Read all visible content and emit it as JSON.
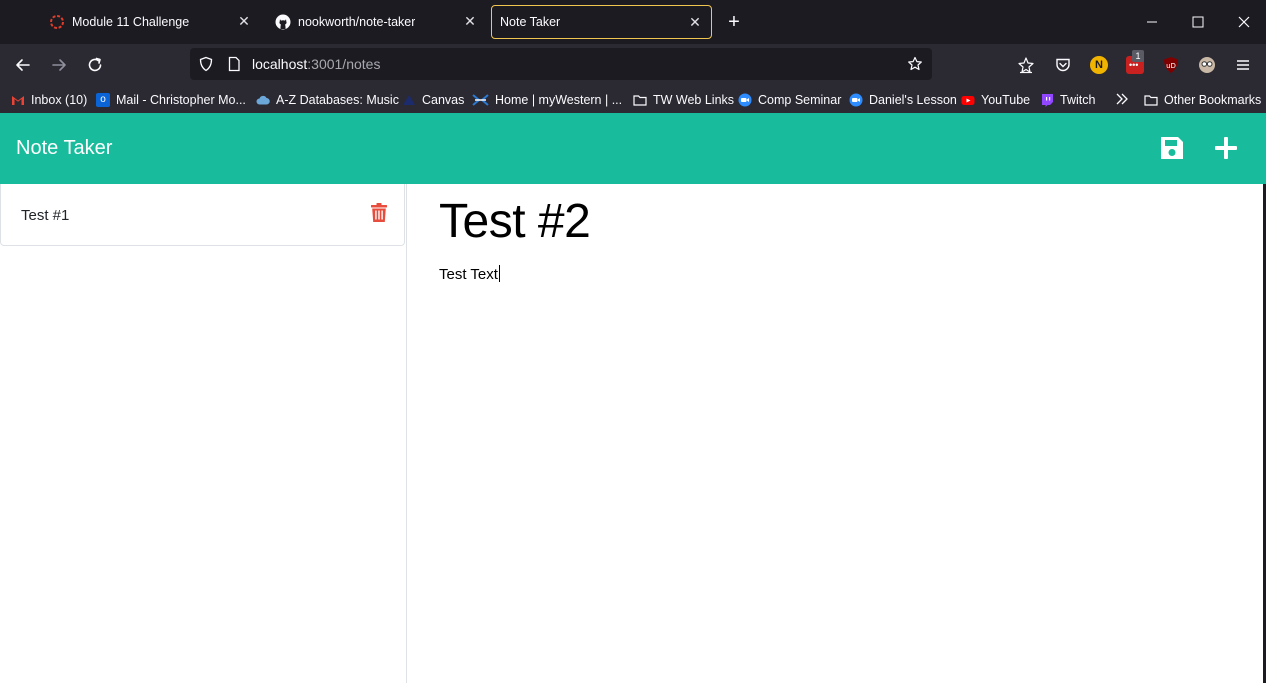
{
  "browser": {
    "tabs": [
      {
        "title": "Module 11 Challenge",
        "icon": "canvas-icon"
      },
      {
        "title": "nookworth/note-taker",
        "icon": "github-icon"
      },
      {
        "title": "Note Taker",
        "icon": "",
        "active": true
      }
    ],
    "url": {
      "host": "localhost",
      "rest": ":3001/notes"
    },
    "bookmarks": [
      {
        "label": "Inbox (10)",
        "icon": "gmail-icon",
        "color": "#ea4335"
      },
      {
        "label": "Mail - Christopher Mo...",
        "icon": "outlook-icon",
        "color": "#0a64d6"
      },
      {
        "label": "A-Z Databases: Music",
        "icon": "cloud-icon",
        "color": "#6ba7d8"
      },
      {
        "label": "Canvas",
        "icon": "canvas-icon",
        "color": "#1c2b6b"
      },
      {
        "label": "Home | myWestern | ...",
        "icon": "western-icon",
        "color": "#2a7ad3"
      },
      {
        "label": "TW Web Links",
        "icon": "folder-icon",
        "color": "#fbfbfe"
      },
      {
        "label": "Comp Seminar",
        "icon": "zoom-icon",
        "color": "#2d8cff"
      },
      {
        "label": "Daniel's Lesson",
        "icon": "zoom-icon",
        "color": "#2d8cff"
      },
      {
        "label": "YouTube",
        "icon": "youtube-icon",
        "color": "#ff0000"
      },
      {
        "label": "Twitch",
        "icon": "twitch-icon",
        "color": "#9146ff"
      },
      {
        "label": "Other Bookmarks",
        "icon": "folder-icon",
        "color": "#fbfbfe"
      }
    ],
    "extension_badge": "1",
    "extension_avatar_letter": "N"
  },
  "app": {
    "title": "Note Taker",
    "accent_color": "#18bc9c",
    "notes": [
      {
        "title": "Test #1"
      }
    ],
    "active_note": {
      "title": "Test #2",
      "text": "Test Text"
    }
  }
}
